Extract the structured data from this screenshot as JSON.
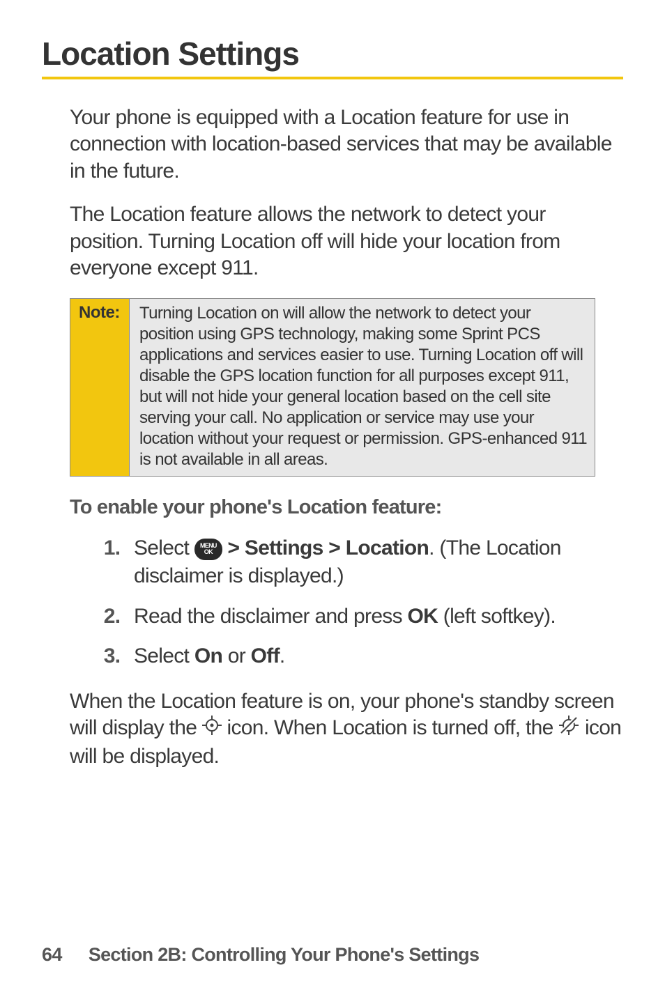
{
  "heading": "Location Settings",
  "para1": "Your phone is equipped with a Location feature for use in connection with location-based services that may be available in the future.",
  "para2": "The Location feature allows the network to detect your position. Turning Location off will hide your location from everyone except 911.",
  "note": {
    "label": "Note:",
    "text": "Turning Location on will allow the network to detect your position using GPS technology, making some Sprint PCS applications and services easier to use. Turning Location off will disable the GPS location function for all purposes except 911, but will not hide your general location based on the cell site serving your call. No application or service may use your location without your request or permission. GPS-enhanced 911 is not available in all areas."
  },
  "subheading": "To enable your phone's Location feature:",
  "steps": {
    "s1": {
      "pre": "Select ",
      "menu_top": "MENU",
      "menu_bot": "OK",
      "path": " > Settings > Location",
      "post": ". (The Location disclaimer is displayed.)"
    },
    "s2": {
      "pre": "Read the disclaimer and press ",
      "ok": "OK",
      "post": " (left softkey)."
    },
    "s3": {
      "pre": "Select ",
      "on": "On",
      "mid": " or ",
      "off": "Off",
      "post": "."
    }
  },
  "closing": {
    "pre": "When the Location feature is on, your phone's standby screen will display the ",
    "mid": " icon. When Location is turned off, the ",
    "post": " icon will be displayed."
  },
  "footer": {
    "page": "64",
    "text": "Section 2B: Controlling Your Phone's Settings"
  }
}
